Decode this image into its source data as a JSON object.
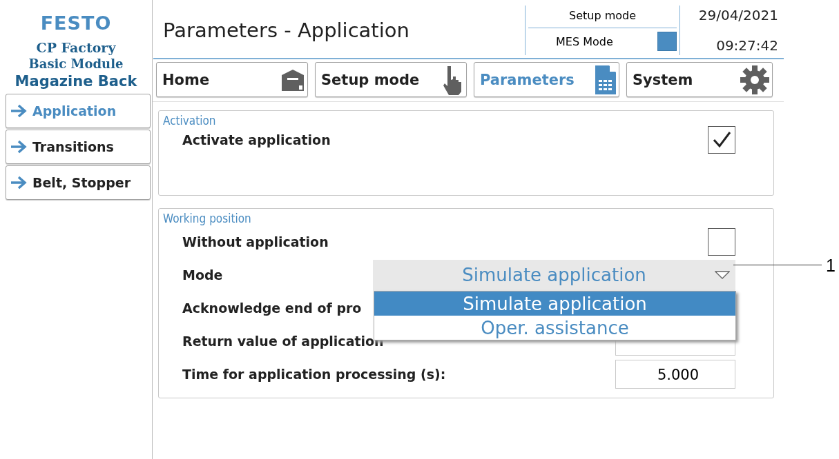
{
  "logo": "FESTO",
  "station": {
    "line1": "CP Factory",
    "line2": "Basic Module",
    "name": "Magazine Back"
  },
  "side_menu": [
    {
      "label": "Application",
      "selected": true
    },
    {
      "label": "Transitions",
      "selected": false
    },
    {
      "label": "Belt, Stopper",
      "selected": false
    }
  ],
  "header": {
    "title": "Parameters - Application",
    "setup_mode": "Setup mode",
    "mes_mode": {
      "label": "MES Mode",
      "on": true
    },
    "date": "29/04/2021",
    "time": "09:27:42"
  },
  "nav": [
    {
      "label": "Home",
      "selected": false
    },
    {
      "label": "Setup mode",
      "selected": false
    },
    {
      "label": "Parameters",
      "selected": true
    },
    {
      "label": "System",
      "selected": false
    }
  ],
  "panels": [
    {
      "title": "Activation",
      "rows": [
        {
          "kind": "checkbox",
          "label": "Activate application",
          "checked": true
        }
      ]
    },
    {
      "title": "Working position",
      "rows": [
        {
          "kind": "checkbox",
          "label": "Without application",
          "checked": false
        },
        {
          "kind": "dropdown",
          "label": "Mode",
          "value": "Simulate application",
          "expanded": true,
          "options": [
            {
              "label": "Simulate application",
              "selected": true
            },
            {
              "label": "Oper. assistance",
              "selected": false
            }
          ]
        },
        {
          "kind": "label",
          "label": "Acknowledge end of pro"
        },
        {
          "kind": "number",
          "label": "Return value of application"
        },
        {
          "kind": "number",
          "label": "Time for application processing (s):",
          "value": "5.000"
        }
      ]
    }
  ],
  "callout": "1"
}
